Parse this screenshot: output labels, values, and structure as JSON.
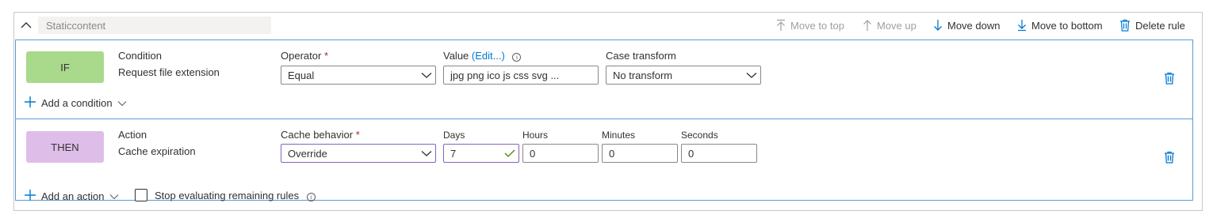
{
  "header": {
    "rule_name": "Staticcontent",
    "move_to_top": "Move to top",
    "move_up": "Move up",
    "move_down": "Move down",
    "move_to_bottom": "Move to bottom",
    "delete_rule": "Delete rule"
  },
  "if_section": {
    "badge": "IF",
    "condition_label": "Condition",
    "condition_value": "Request file extension",
    "operator_label": "Operator",
    "operator_required": "*",
    "operator_value": "Equal",
    "value_label": "Value",
    "value_edit": "(Edit...)",
    "value_value": "jpg  png  ico  js    css  svg  ...",
    "case_label": "Case transform",
    "case_value": "No transform",
    "add_condition": "Add a condition"
  },
  "then_section": {
    "badge": "THEN",
    "action_label": "Action",
    "action_value": "Cache expiration",
    "cache_label": "Cache behavior",
    "cache_required": "*",
    "cache_value": "Override",
    "days_label": "Days",
    "days_value": "7",
    "hours_label": "Hours",
    "hours_value": "0",
    "minutes_label": "Minutes",
    "minutes_value": "0",
    "seconds_label": "Seconds",
    "seconds_value": "0",
    "add_action": "Add an action",
    "stop_label": "Stop evaluating remaining rules"
  },
  "colors": {
    "accent": "#0078d4",
    "if_badge": "#a9d98b",
    "then_badge": "#dfbde9",
    "section_border": "#5b9bd5",
    "required": "#a4262c",
    "check": "#498205"
  },
  "icons": {
    "collapse": "chevron-up-icon",
    "move_to_top": "arrow-to-top-icon",
    "move_up": "arrow-up-icon",
    "move_down": "arrow-down-icon",
    "move_to_bottom": "arrow-to-bottom-icon",
    "delete": "trash-icon",
    "add": "plus-icon",
    "info": "info-icon",
    "valid": "checkmark-icon"
  }
}
